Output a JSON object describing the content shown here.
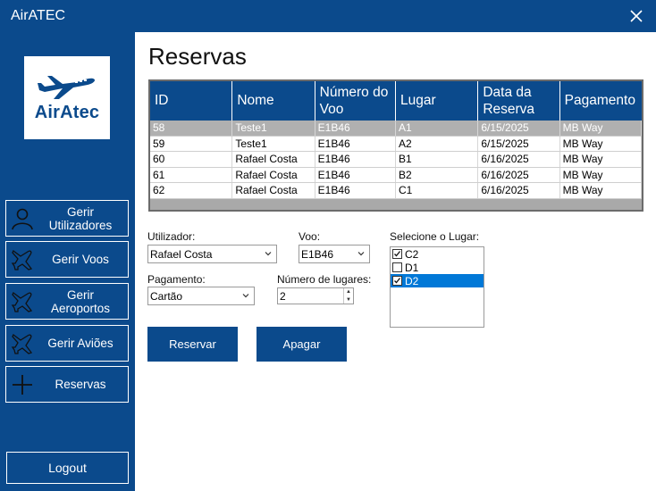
{
  "window": {
    "title": "AirATEC"
  },
  "logo": {
    "text": "AirAtec"
  },
  "sidebar": {
    "items": [
      {
        "label": "Gerir Utilizadores",
        "icon": "user-icon"
      },
      {
        "label": "Gerir Voos",
        "icon": "airplane-icon"
      },
      {
        "label": "Gerir Aeroportos",
        "icon": "airplane-icon"
      },
      {
        "label": "Gerir Aviões",
        "icon": "airplane-icon"
      },
      {
        "label": "Reservas",
        "icon": "plus-icon"
      }
    ],
    "logout_label": "Logout"
  },
  "main": {
    "title": "Reservas",
    "grid": {
      "headers": [
        "ID",
        "Nome",
        "Número do Voo",
        "Lugar",
        "Data da Reserva",
        "Pagamento"
      ],
      "rows": [
        {
          "id": "58",
          "nome": "Teste1",
          "voo": "E1B46",
          "lugar": "A1",
          "data": "6/15/2025",
          "pagamento": "MB Way"
        },
        {
          "id": "59",
          "nome": "Teste1",
          "voo": "E1B46",
          "lugar": "A2",
          "data": "6/15/2025",
          "pagamento": "MB Way"
        },
        {
          "id": "60",
          "nome": "Rafael Costa",
          "voo": "E1B46",
          "lugar": "B1",
          "data": "6/16/2025",
          "pagamento": "MB Way"
        },
        {
          "id": "61",
          "nome": "Rafael Costa",
          "voo": "E1B46",
          "lugar": "B2",
          "data": "6/16/2025",
          "pagamento": "MB Way"
        },
        {
          "id": "62",
          "nome": "Rafael Costa",
          "voo": "E1B46",
          "lugar": "C1",
          "data": "6/16/2025",
          "pagamento": "MB Way"
        }
      ],
      "selected_row": 0
    },
    "form": {
      "utilizador_label": "Utilizador:",
      "utilizador_value": "Rafael Costa",
      "voo_label": "Voo:",
      "voo_value": "E1B46",
      "pagamento_label": "Pagamento:",
      "pagamento_value": "Cartão",
      "lugares_label": "Número de lugares:",
      "lugares_value": "2",
      "lugar_label": "Selecione o Lugar:",
      "seats": [
        {
          "label": "C2",
          "checked": true,
          "selected": false
        },
        {
          "label": "D1",
          "checked": false,
          "selected": false
        },
        {
          "label": "D2",
          "checked": true,
          "selected": true
        }
      ]
    },
    "buttons": {
      "reservar": "Reservar",
      "apagar": "Apagar"
    }
  },
  "colors": {
    "primary": "#0b4a8c",
    "selection": "#0078d7",
    "grid_selected": "#b0b0b0"
  }
}
